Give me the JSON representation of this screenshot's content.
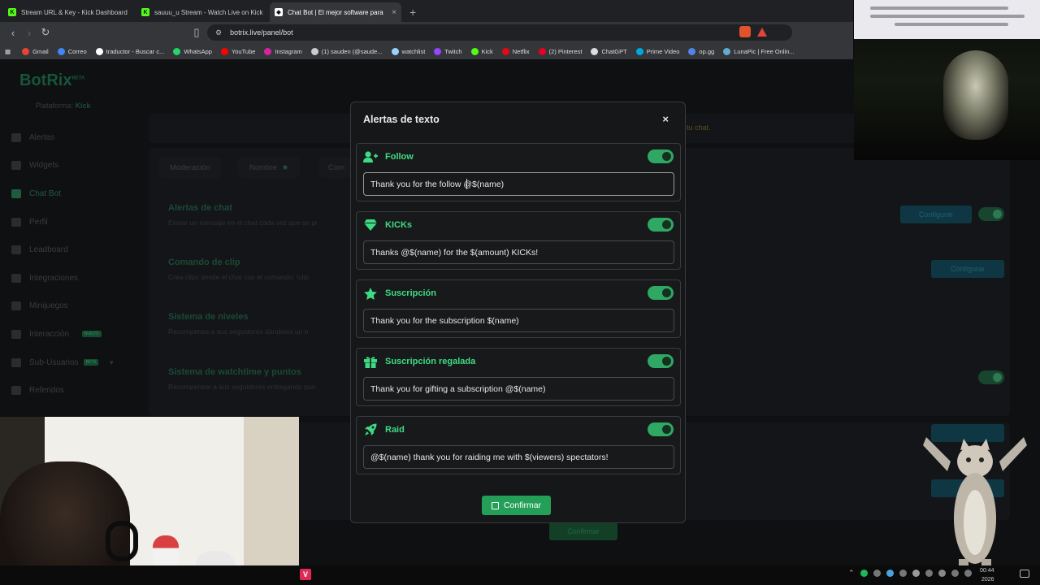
{
  "browser": {
    "tabs": [
      {
        "title": "Stream URL & Key - Kick Dashboard",
        "icon": "kick-icon",
        "color": "#53fc18"
      },
      {
        "title": "sauuu_u Stream - Watch Live on Kick",
        "icon": "kick-icon",
        "color": "#53fc18"
      },
      {
        "title": "Chat Bot | El mejor software para",
        "icon": "botrix-icon",
        "color": "#ffffff"
      }
    ],
    "url": "botrix.live/panel/bot",
    "bookmarks": [
      {
        "label": "Gmail",
        "color": "#ea4335"
      },
      {
        "label": "Correo",
        "color": "#4285f4"
      },
      {
        "label": "traductor - Buscar c...",
        "color": "#ffffff"
      },
      {
        "label": "WhatsApp",
        "color": "#25d366"
      },
      {
        "label": "YouTube",
        "color": "#ff0000"
      },
      {
        "label": "Instagram",
        "color": "#d6249f"
      },
      {
        "label": "(1) sauden (@saude...",
        "color": "#cccccc"
      },
      {
        "label": "watchlist",
        "color": "#9ad1ff"
      },
      {
        "label": "Twitch",
        "color": "#9146ff"
      },
      {
        "label": "Kick",
        "color": "#53fc18"
      },
      {
        "label": "Netflix",
        "color": "#e50914"
      },
      {
        "label": "(2) Pinterest",
        "color": "#e60023"
      },
      {
        "label": "ChatGPT",
        "color": "#dddddd"
      },
      {
        "label": "Prime Video",
        "color": "#00a8e1"
      },
      {
        "label": "op.gg",
        "color": "#5383e8"
      },
      {
        "label": "LunaPic | Free Onlin...",
        "color": "#6ac"
      }
    ]
  },
  "app": {
    "logo": "BotRix",
    "logo_badge": "BETA",
    "platform_label": "Plataforma:",
    "platform_value": "Kick",
    "sidebar": [
      {
        "label": "Alertas"
      },
      {
        "label": "Widgets"
      },
      {
        "label": "Chat Bot"
      },
      {
        "label": "Perfil"
      },
      {
        "label": "Leadboard"
      },
      {
        "label": "Integraciones"
      },
      {
        "label": "Minijuegos"
      },
      {
        "label": "Interacción",
        "badge": "NUEVO"
      },
      {
        "label": "Sub-Usuarios",
        "badge": "BETA"
      },
      {
        "label": "Referidos"
      }
    ],
    "tabs": [
      "Moderación",
      "Nombre",
      "Com"
    ],
    "rows": [
      {
        "title": "Alertas de chat",
        "desc": "Enviar un mensaje en el chat cada vez que se pr",
        "button": "Configurar"
      },
      {
        "title": "Comando de clip",
        "desc": "Crea clips desde el chat con el comando: !clip",
        "button": "Configurar"
      },
      {
        "title": "Sistema de niveles",
        "desc": "Recompensa a sus seguidores dándoles un n"
      },
      {
        "title": "Sistema de watchtime y puntos",
        "desc": "Recompensar a sus seguidores entregando pun"
      }
    ],
    "bg_confirm": "Confirmar",
    "banner_text": "tu chat."
  },
  "modal": {
    "title": "Alertas de texto",
    "close": "×",
    "alerts": [
      {
        "name": "Follow",
        "icon": "user-plus-icon",
        "value": "Thank you for the follow @$(name)",
        "enabled": true
      },
      {
        "name": "KICKs",
        "icon": "gem-icon",
        "value": "Thanks @$(name) for the $(amount) KICKs!",
        "enabled": true
      },
      {
        "name": "Suscripción",
        "icon": "star-icon",
        "value": "Thank you for the subscription $(name)",
        "enabled": true
      },
      {
        "name": "Suscripción regalada",
        "icon": "gift-icon",
        "value": "Thank you for gifting a subscription @$(name)",
        "enabled": true
      },
      {
        "name": "Raid",
        "icon": "rocket-icon",
        "value": "@$(name) thank you for raiding me with $(viewers) spectators!",
        "enabled": true
      }
    ],
    "confirm": "Confirmar",
    "accent": "#3ddc84"
  },
  "taskbar": {
    "time": "00:44",
    "date": "2026"
  }
}
